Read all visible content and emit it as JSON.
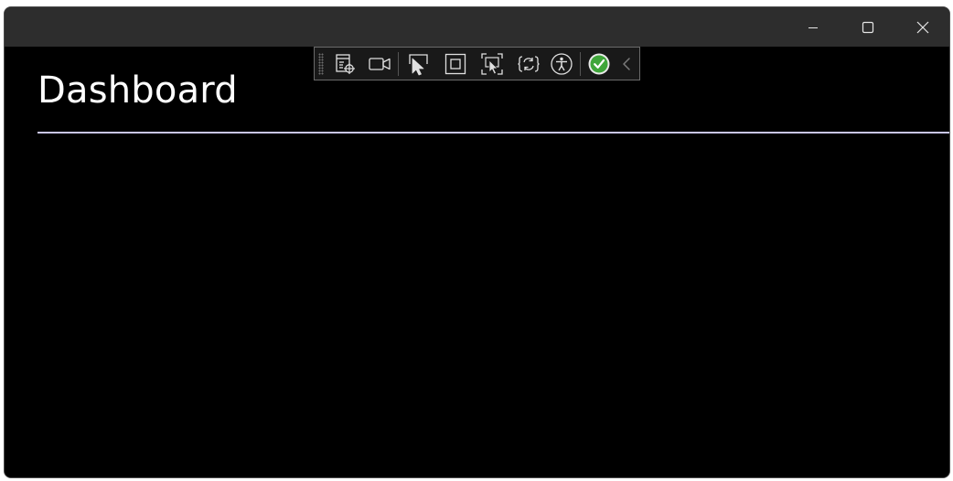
{
  "window": {
    "caption_buttons": [
      {
        "name": "minimize",
        "icon": "minimize-icon"
      },
      {
        "name": "maximize",
        "icon": "maximize-icon"
      },
      {
        "name": "close",
        "icon": "close-icon"
      }
    ]
  },
  "page": {
    "title": "Dashboard"
  },
  "debug_toolbar": {
    "buttons": [
      {
        "icon": "live-visual-tree-icon"
      },
      {
        "icon": "video-camera-icon"
      },
      {
        "icon": "select-element-icon"
      },
      {
        "icon": "display-layout-adorners-icon"
      },
      {
        "icon": "track-focused-element-icon"
      },
      {
        "icon": "hot-reload-icon"
      },
      {
        "icon": "accessibility-icon"
      },
      {
        "icon": "checkmark-status-icon"
      },
      {
        "icon": "chevron-left-icon"
      }
    ]
  },
  "colors": {
    "titlebar": "#2d2d2d",
    "content_background": "#000000",
    "title_text": "#ffffff",
    "title_rule": "#c9c6ec",
    "toolbar_background": "#191919",
    "status_green": "#3fa63a"
  }
}
